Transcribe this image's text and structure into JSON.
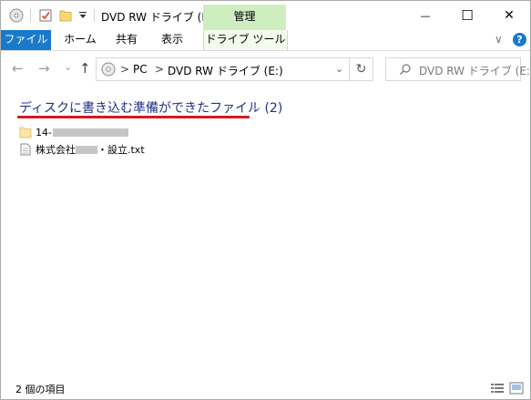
{
  "titlebar": {
    "title": "DVD RW ドライブ (E:)",
    "manage_label": "管理",
    "minimize_glyph": "—",
    "maximize_glyph": "☐",
    "close_glyph": "✕"
  },
  "ribbon": {
    "tabs": [
      {
        "label": "ファイル"
      },
      {
        "label": "ホーム"
      },
      {
        "label": "共有"
      },
      {
        "label": "表示"
      },
      {
        "label": "ドライブ ツール"
      }
    ],
    "expand_glyph": "∨",
    "help_glyph": "?"
  },
  "nav": {
    "back_glyph": "←",
    "forward_glyph": "→",
    "recent_glyph": "⌄",
    "up_glyph": "↑",
    "breadcrumb": [
      "PC",
      "DVD RW ドライブ (E:)"
    ],
    "separator": ">",
    "dropdown_glyph": "⌄",
    "refresh_glyph": "↻",
    "search_placeholder": "DVD RW ドライブ (E:..."
  },
  "content": {
    "group_header": "ディスクに書き込む準備ができたファイル (2)",
    "items": [
      {
        "name_prefix": "14-",
        "name_suffix": "",
        "type": "folder"
      },
      {
        "name_prefix": "株式会社",
        "name_suffix": "・設立.txt",
        "type": "text-file"
      }
    ]
  },
  "status": {
    "item_count": "2 個の項目"
  },
  "colors": {
    "accent": "#1979ca",
    "manage_tab": "#cfeec0",
    "group_header": "#1e3287",
    "annotation_underline": "#d71920"
  }
}
